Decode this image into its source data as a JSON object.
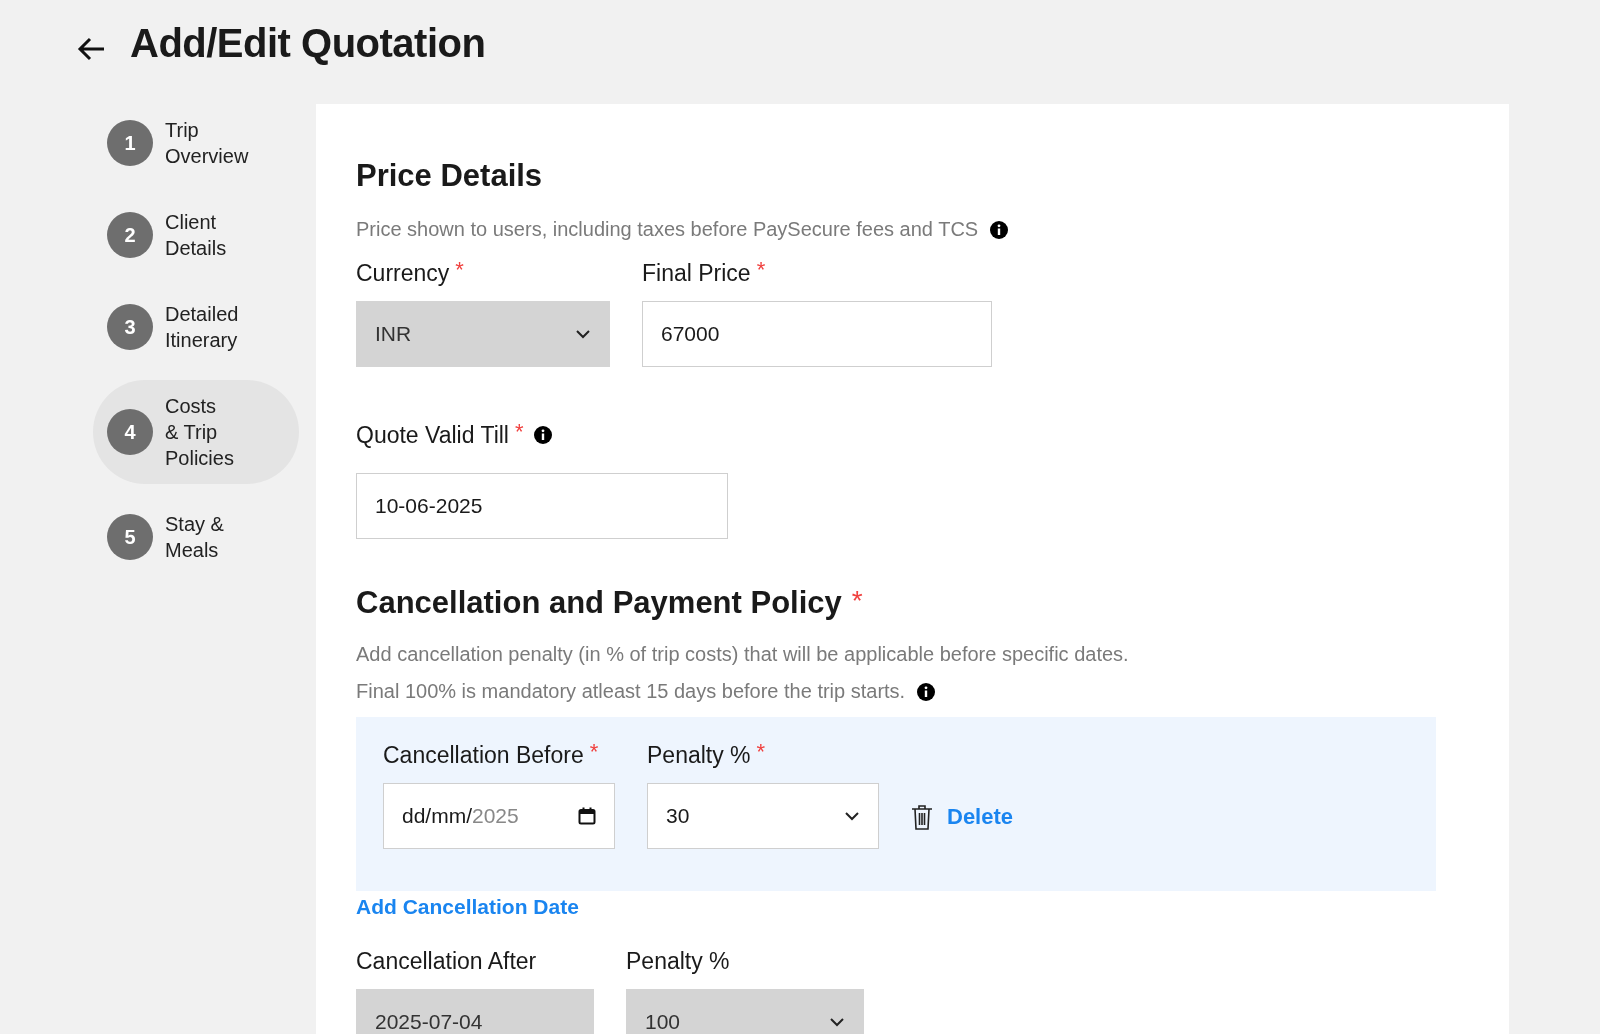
{
  "header": {
    "title": "Add/Edit Quotation"
  },
  "steps": [
    {
      "number": "1",
      "label": "Trip\nOverview",
      "selected": false
    },
    {
      "number": "2",
      "label": "Client\nDetails",
      "selected": false
    },
    {
      "number": "3",
      "label": "Detailed\nItinerary",
      "selected": false
    },
    {
      "number": "4",
      "label": "Costs\n& Trip\nPolicies",
      "selected": true
    },
    {
      "number": "5",
      "label": "Stay &\nMeals",
      "selected": false
    }
  ],
  "price_details": {
    "title": "Price Details",
    "hint": "Price shown to users, including taxes before PaySecure fees and TCS",
    "hint_info": true,
    "rows": [
      {
        "fields": [
          {
            "kind": "select",
            "label": "Currency",
            "required_mark": "*",
            "value": "INR",
            "disabled": true
          },
          {
            "kind": "text",
            "label": "Final Price",
            "required_mark": "*",
            "value": "67000",
            "disabled": false
          }
        ]
      },
      {
        "fields": [
          {
            "kind": "text",
            "label": "Quote Valid Till",
            "required_mark": "*",
            "info": true,
            "value": "10-06-2025",
            "disabled": false
          }
        ]
      }
    ]
  },
  "cancellation_policy": {
    "title": "Cancellation and Payment Policy",
    "required_mark": "*",
    "hints": [
      {
        "text": "Add cancellation penalty (in % of trip costs) that will be applicable before specific dates."
      },
      {
        "text": "Final 100% is mandatory atleast 15 days before the trip starts.",
        "info": true
      }
    ],
    "entries": [
      {
        "fields": [
          {
            "kind": "date",
            "label": "Cancellation Before",
            "required_mark": "*",
            "value": "dd/mm/",
            "dim_value": "2025",
            "disabled": false
          },
          {
            "kind": "select",
            "label": "Penalty %",
            "required_mark": "*",
            "value": "30",
            "disabled": false
          }
        ],
        "delete_label": "Delete"
      }
    ],
    "add_link": "Add Cancellation Date",
    "final": {
      "fields": [
        {
          "kind": "text",
          "label": "Cancellation After",
          "value": "2025-07-04",
          "disabled": true
        },
        {
          "kind": "select",
          "label": "Penalty %",
          "value": "100",
          "disabled": true
        }
      ]
    }
  }
}
